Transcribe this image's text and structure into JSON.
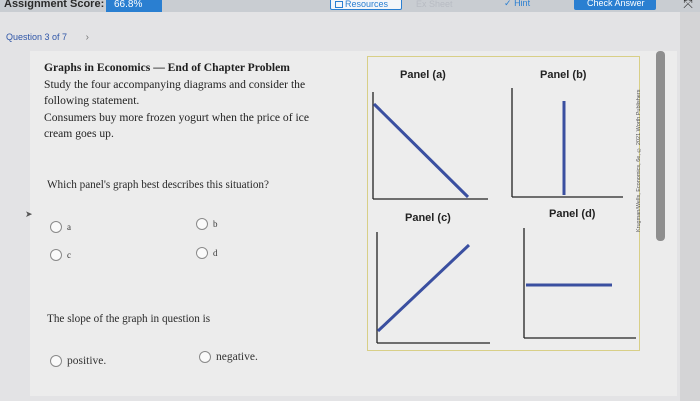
{
  "topbar": {
    "score_label": "Assignment Score:",
    "score_value": "66.8%",
    "resources_label": "Resources",
    "ghost_label": "Ex Sheet",
    "hint_label": "Hint",
    "check_answer_label": "Check Answer",
    "expand_glyph": "⤧"
  },
  "nav": {
    "question_label": "Question 3 of 7",
    "next_glyph": "›"
  },
  "question": {
    "title": "Graphs in Economics — End of Chapter Problem",
    "line1": "Study the four accompanying diagrams and consider the",
    "line2": "following statement.",
    "line3": "Consumers buy more frozen yogurt when the price of ice",
    "line4": "cream goes up.",
    "prompt1": "Which panel's graph best describes this situation?",
    "options1": [
      "a",
      "b",
      "c",
      "d"
    ],
    "prompt2": "The slope of the graph in question is",
    "options2": [
      "positive.",
      "negative."
    ]
  },
  "graphs": {
    "panels": [
      "Panel (a)",
      "Panel (b)",
      "Panel (c)",
      "Panel (d)"
    ],
    "line_color": "#3a4fa0",
    "copyright": "Krugman/Wells, Economics, 6e, © 2021 Worth Publishers"
  }
}
